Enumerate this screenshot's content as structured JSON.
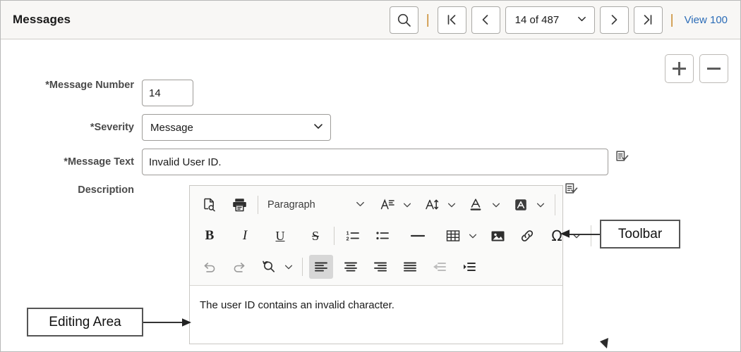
{
  "header": {
    "title": "Messages",
    "search_icon": "search-icon",
    "first_label": "|<",
    "prev_label": "<",
    "counter": "14 of 487",
    "next_label": ">",
    "last_label": ">|",
    "divider": "|",
    "view_link": "View 100"
  },
  "actions": {
    "add_label": "+",
    "remove_label": "−"
  },
  "form": {
    "fields": [
      {
        "label": "*Message Number",
        "value": "14",
        "type": "text"
      },
      {
        "label": "*Severity",
        "value": "Message",
        "type": "select"
      },
      {
        "label": "*Message Text",
        "value": "Invalid User ID.",
        "type": "text"
      },
      {
        "label": "Description",
        "value": "",
        "type": "richtext"
      }
    ]
  },
  "editor": {
    "paragraph_style": "Paragraph",
    "content": "The user ID contains an invalid character.",
    "row1": [
      {
        "name": "source-preview-icon",
        "label": "Preview"
      },
      {
        "name": "print-icon",
        "label": "Print"
      },
      {
        "name": "paragraph-format-dropdown",
        "label": "Paragraph"
      },
      {
        "name": "font-family-icon",
        "label": "Font"
      },
      {
        "name": "font-size-icon",
        "label": "Font Size"
      },
      {
        "name": "font-color-icon",
        "label": "Font Color"
      },
      {
        "name": "background-color-icon",
        "label": "Background Color"
      }
    ],
    "row2": [
      {
        "name": "bold-icon",
        "label": "B"
      },
      {
        "name": "italic-icon",
        "label": "I"
      },
      {
        "name": "underline-icon",
        "label": "U"
      },
      {
        "name": "strikethrough-icon",
        "label": "S"
      },
      {
        "name": "numbered-list-icon",
        "label": "Numbered List"
      },
      {
        "name": "bulleted-list-icon",
        "label": "Bulleted List"
      },
      {
        "name": "horizontal-rule-icon",
        "label": "Horizontal Line"
      },
      {
        "name": "table-icon",
        "label": "Table"
      },
      {
        "name": "image-icon",
        "label": "Image"
      },
      {
        "name": "link-icon",
        "label": "Link"
      },
      {
        "name": "special-character-icon",
        "label": "Special Character"
      }
    ],
    "row3": [
      {
        "name": "undo-icon",
        "label": "Undo"
      },
      {
        "name": "redo-icon",
        "label": "Redo"
      },
      {
        "name": "find-replace-icon",
        "label": "Find and Replace"
      },
      {
        "name": "align-left-icon",
        "label": "Align Left",
        "active": true
      },
      {
        "name": "align-center-icon",
        "label": "Align Center"
      },
      {
        "name": "align-right-icon",
        "label": "Align Right"
      },
      {
        "name": "align-justify-icon",
        "label": "Justify"
      },
      {
        "name": "outdent-icon",
        "label": "Decrease Indent",
        "disabled": true
      },
      {
        "name": "indent-icon",
        "label": "Increase Indent"
      }
    ]
  },
  "callouts": {
    "toolbar": "Toolbar",
    "editing_area": "Editing Area"
  },
  "colors": {
    "link": "#2b6cb7",
    "pipe": "#c98b2e",
    "header_bg": "#f8f7f5",
    "label": "#4a4a4a",
    "toolbar_bg": "#fafaf9",
    "active_button": "#d7d7d7"
  }
}
